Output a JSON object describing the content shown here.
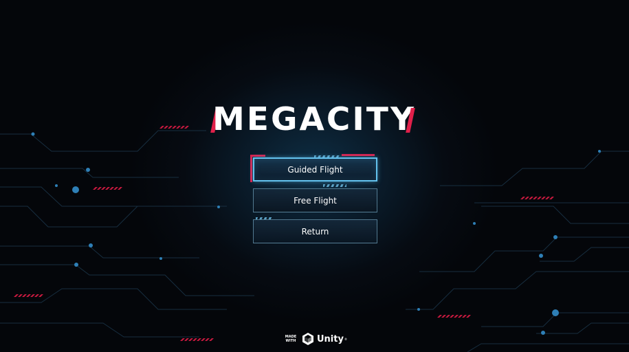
{
  "app": {
    "title": "MEGACITY"
  },
  "menu": {
    "items": [
      {
        "label": "Guided Flight",
        "selected": true
      },
      {
        "label": "Free Flight",
        "selected": false
      },
      {
        "label": "Return",
        "selected": false
      }
    ]
  },
  "footer": {
    "made_with": "MADE WITH",
    "engine": "Unity",
    "trademark": "®"
  },
  "colors": {
    "accent_red": "#e0204a",
    "accent_blue": "#63c2ee",
    "background": "#05070a"
  }
}
